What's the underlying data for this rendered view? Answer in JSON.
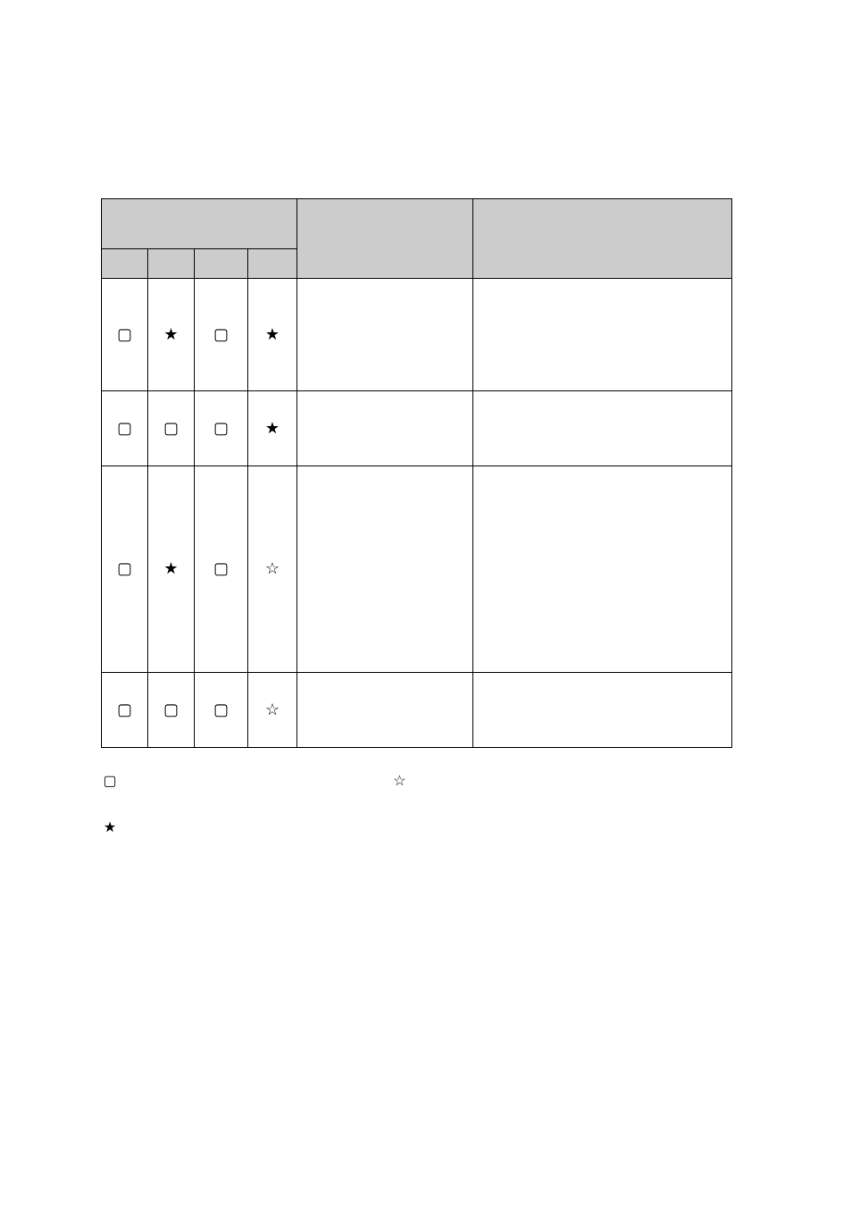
{
  "glyphs": {
    "box": "▢",
    "star_filled": "★",
    "star_outline": "☆"
  },
  "table": {
    "rows": [
      {
        "c0": "box",
        "c1": "star_filled",
        "c2": "box",
        "c3": "star_filled"
      },
      {
        "c0": "box",
        "c1": "box",
        "c2": "box",
        "c3": "star_filled"
      },
      {
        "c0": "box",
        "c1": "star_filled",
        "c2": "box",
        "c3": "star_outline"
      },
      {
        "c0": "box",
        "c1": "box",
        "c2": "box",
        "c3": "star_outline"
      }
    ]
  },
  "legend": {
    "line1_left_icon": "box",
    "line1_right_icon": "star_outline",
    "line2_icon": "star_filled"
  }
}
